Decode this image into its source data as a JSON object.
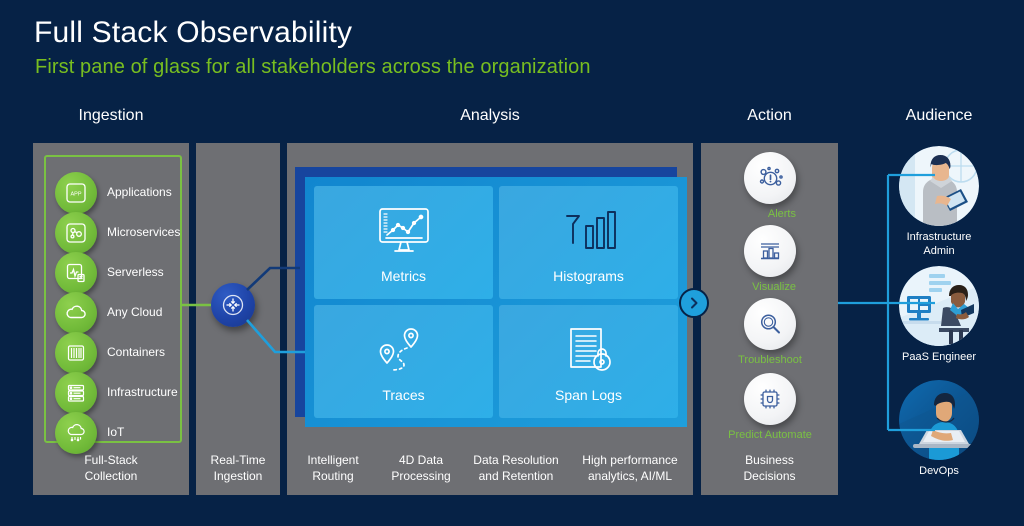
{
  "header": {
    "title": "Full Stack Observability",
    "subtitle": "First pane of glass for all stakeholders across the organization"
  },
  "colors": {
    "background": "#062246",
    "panel": "#6e6f73",
    "green": "#78be20",
    "green_accent": "#7ac143",
    "blue_card": "#1f9fdc",
    "blue_card_back": "#17459e",
    "node_blue": "#1f44a8",
    "link_blue": "#1f9fdc",
    "white": "#ffffff"
  },
  "columns": [
    {
      "id": "ingestion",
      "heading": "Ingestion"
    },
    {
      "id": "analysis",
      "heading": "Analysis"
    },
    {
      "id": "action",
      "heading": "Action"
    },
    {
      "id": "audience",
      "heading": "Audience"
    }
  ],
  "ingestion": {
    "heading": "Ingestion",
    "caption": "Full-Stack\nCollection",
    "caption_line1": "Full-Stack",
    "caption_line2": "Collection",
    "items": [
      {
        "label": "Applications",
        "icon": "application-window-icon"
      },
      {
        "label": "Microservices",
        "icon": "microservices-icon"
      },
      {
        "label": "Serverless",
        "icon": "serverless-function-icon"
      },
      {
        "label": "Any Cloud",
        "icon": "cloud-icon"
      },
      {
        "label": "Containers",
        "icon": "containers-icon"
      },
      {
        "label": "Infrastructure",
        "icon": "server-rack-icon"
      },
      {
        "label": "IoT",
        "icon": "iot-cloud-icon"
      }
    ]
  },
  "realtime": {
    "caption_line1": "Real-Time",
    "caption_line2": "Ingestion",
    "node_icon": "converge-arrows-icon"
  },
  "analysis": {
    "heading": "Analysis",
    "tiles": [
      {
        "label": "Metrics",
        "icon": "monitor-line-chart-icon"
      },
      {
        "label": "Histograms",
        "icon": "histogram-bars-icon"
      },
      {
        "label": "Traces",
        "icon": "trace-pins-path-icon"
      },
      {
        "label": "Span Logs",
        "icon": "document-lock-icon"
      }
    ],
    "captions": [
      {
        "line1": "Intelligent",
        "line2": "Routing"
      },
      {
        "line1": "4D Data",
        "line2": "Processing"
      },
      {
        "line1": "Data Resolution",
        "line2": "and Retention"
      },
      {
        "line1": "High performance",
        "line2": "analytics, AI/ML"
      }
    ],
    "chevron_icon": "chevron-right-icon"
  },
  "action": {
    "heading": "Action",
    "items": [
      {
        "label": "Alerts",
        "icon": "alert-bubble-icon"
      },
      {
        "label": "Visualize",
        "icon": "bar-chart-dashboard-icon"
      },
      {
        "label": "Troubleshoot",
        "icon": "magnifier-icon"
      },
      {
        "label": "Predict Automate",
        "icon": "chip-ai-icon"
      }
    ],
    "caption_line1": "Business",
    "caption_line2": "Decisions"
  },
  "audience": {
    "heading": "Audience",
    "items": [
      {
        "label_line1": "Infrastructure",
        "label_line2": "Admin",
        "icon": "person-tablet-avatar-icon"
      },
      {
        "label_line1": "PaaS Engineer",
        "label_line2": "",
        "icon": "person-desk-avatar-icon"
      },
      {
        "label_line1": "DevOps",
        "label_line2": "",
        "icon": "person-laptop-avatar-icon"
      }
    ]
  }
}
